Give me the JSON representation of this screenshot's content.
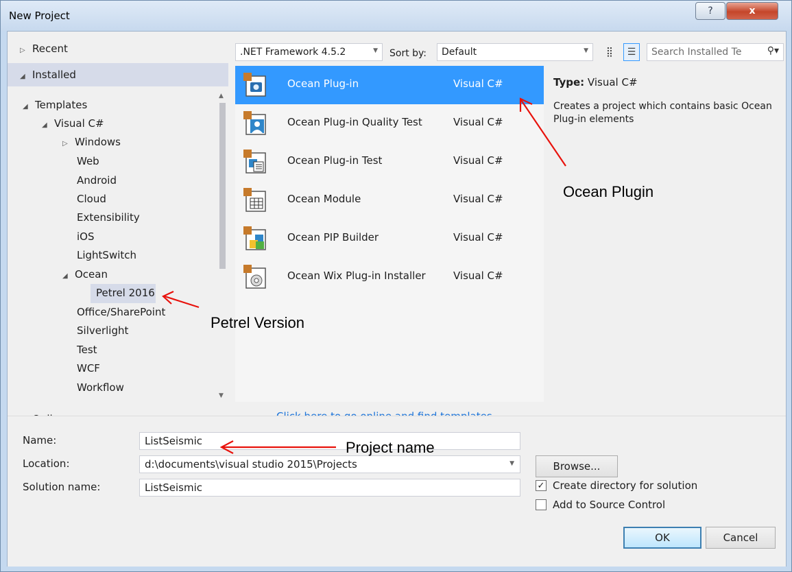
{
  "window": {
    "title": "New Project",
    "help_glyph": "?",
    "close_glyph": "x"
  },
  "tree": {
    "recent": "Recent",
    "installed": "Installed",
    "templates": "Templates",
    "visual_csharp": "Visual C#",
    "windows": "Windows",
    "children": [
      "Web",
      "Android",
      "Cloud",
      "Extensibility",
      "iOS",
      "LightSwitch"
    ],
    "ocean": "Ocean",
    "petrel": "Petrel 2016",
    "after_ocean": [
      "Office/SharePoint",
      "Silverlight",
      "Test",
      "WCF",
      "Workflow"
    ],
    "online": "Online"
  },
  "toolbar": {
    "framework": ".NET Framework 4.5.2",
    "sort_label": "Sort by:",
    "sort_value": "Default",
    "search_placeholder": "Search Installed Te"
  },
  "templates": [
    {
      "name": "Ocean Plug-in",
      "lang": "Visual C#",
      "icon": "camera-icon"
    },
    {
      "name": "Ocean Plug-in Quality Test",
      "lang": "Visual C#",
      "icon": "person-icon"
    },
    {
      "name": "Ocean Plug-in Test",
      "lang": "Visual C#",
      "icon": "document-icon"
    },
    {
      "name": "Ocean Module",
      "lang": "Visual C#",
      "icon": "grid-icon"
    },
    {
      "name": "Ocean PIP Builder",
      "lang": "Visual C#",
      "icon": "cubes-icon"
    },
    {
      "name": "Ocean Wix Plug-in Installer",
      "lang": "Visual C#",
      "icon": "disc-icon"
    }
  ],
  "description": {
    "type_label": "Type:",
    "type_value": "Visual C#",
    "text": "Creates a project which contains basic Ocean Plug-in elements"
  },
  "online_link": "Click here to go online and find templates.",
  "form": {
    "name_label": "Name:",
    "name_value": "ListSeismic",
    "location_label": "Location:",
    "location_value": "d:\\documents\\visual studio 2015\\Projects",
    "solution_label": "Solution name:",
    "solution_value": "ListSeismic",
    "browse": "Browse...",
    "create_dir": "Create directory for solution",
    "create_dir_checked": true,
    "add_source": "Add to Source Control",
    "add_source_checked": false,
    "ok": "OK",
    "cancel": "Cancel"
  },
  "annotations": {
    "ocean_plugin": "Ocean Plugin",
    "petrel_version": "Petrel Version",
    "project_name": "Project name",
    "arrow_color": "#e8120c"
  }
}
